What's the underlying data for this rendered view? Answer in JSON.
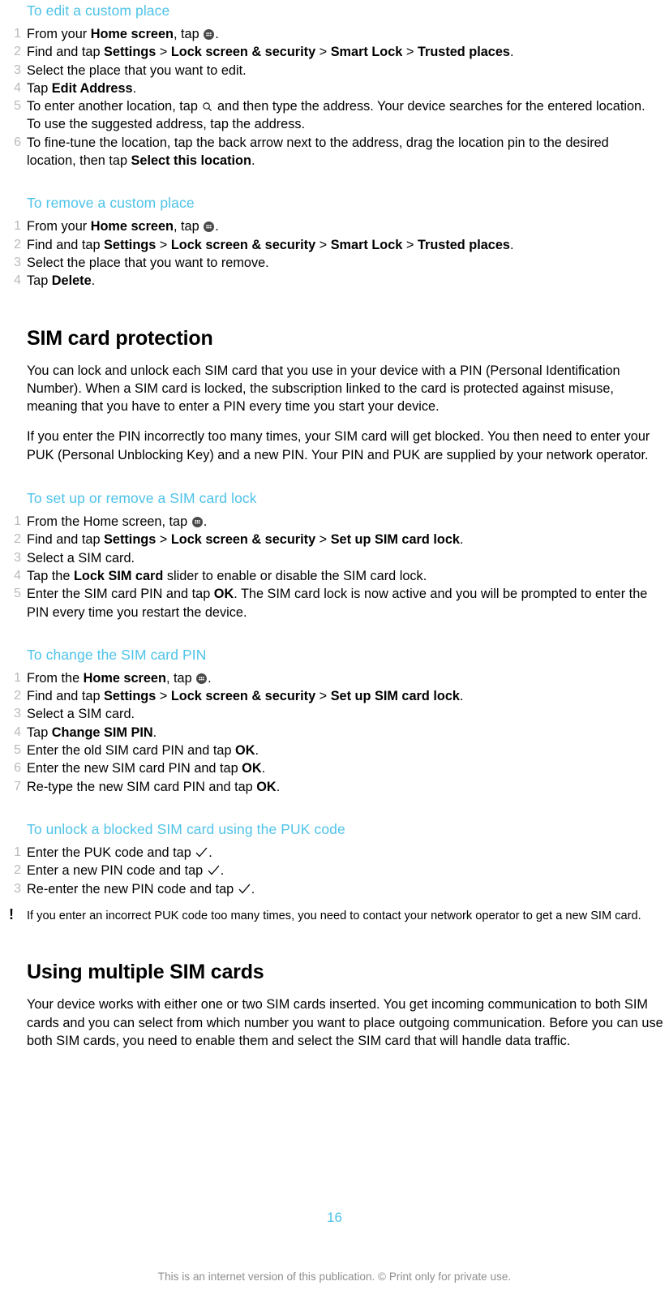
{
  "page": {
    "number": "16",
    "footer_note": "This is an internet version of this publication. © Print only for private use.",
    "accent_color": "#4ec3e8",
    "number_color": "#b9b9b9",
    "footer_color": "#8f8f8f"
  },
  "icons": {
    "app_drawer": "app-drawer-icon",
    "search": "search-icon",
    "check": "check-icon",
    "note": "!"
  },
  "sections": {
    "edit_custom_place": {
      "heading": "To edit a custom place",
      "steps": [
        {
          "num": "1",
          "parts": [
            {
              "t": "From your "
            },
            {
              "t": "Home screen",
              "b": true
            },
            {
              "t": ", tap "
            },
            {
              "icon": "app-drawer"
            },
            {
              "t": "."
            }
          ]
        },
        {
          "num": "2",
          "parts": [
            {
              "t": "Find and tap "
            },
            {
              "t": "Settings",
              "b": true
            },
            {
              "t": " > "
            },
            {
              "t": "Lock screen & security",
              "b": true
            },
            {
              "t": " > "
            },
            {
              "t": "Smart Lock",
              "b": true
            },
            {
              "t": " > "
            },
            {
              "t": "Trusted places",
              "b": true
            },
            {
              "t": "."
            }
          ]
        },
        {
          "num": "3",
          "parts": [
            {
              "t": "Select the place that you want to edit."
            }
          ]
        },
        {
          "num": "4",
          "parts": [
            {
              "t": "Tap "
            },
            {
              "t": "Edit Address",
              "b": true
            },
            {
              "t": "."
            }
          ]
        },
        {
          "num": "5",
          "parts": [
            {
              "t": "To enter another location, tap "
            },
            {
              "icon": "search"
            },
            {
              "t": " and then type the address. Your device searches for the entered location. To use the suggested address, tap the address."
            }
          ]
        },
        {
          "num": "6",
          "parts": [
            {
              "t": "To fine-tune the location, tap the back arrow next to the address, drag the location pin to the desired location, then tap "
            },
            {
              "t": "Select this location",
              "b": true
            },
            {
              "t": "."
            }
          ]
        }
      ]
    },
    "remove_custom_place": {
      "heading": "To remove a custom place",
      "steps": [
        {
          "num": "1",
          "parts": [
            {
              "t": "From your "
            },
            {
              "t": "Home screen",
              "b": true
            },
            {
              "t": ", tap "
            },
            {
              "icon": "app-drawer"
            },
            {
              "t": "."
            }
          ]
        },
        {
          "num": "2",
          "parts": [
            {
              "t": "Find and tap "
            },
            {
              "t": "Settings",
              "b": true
            },
            {
              "t": " > "
            },
            {
              "t": "Lock screen & security",
              "b": true
            },
            {
              "t": " > "
            },
            {
              "t": "Smart Lock",
              "b": true
            },
            {
              "t": " > "
            },
            {
              "t": "Trusted places",
              "b": true
            },
            {
              "t": "."
            }
          ]
        },
        {
          "num": "3",
          "parts": [
            {
              "t": "Select the place that you want to remove."
            }
          ]
        },
        {
          "num": "4",
          "parts": [
            {
              "t": "Tap "
            },
            {
              "t": "Delete",
              "b": true
            },
            {
              "t": "."
            }
          ]
        }
      ]
    },
    "sim_card_protection": {
      "title": "SIM card protection",
      "paragraphs": [
        "You can lock and unlock each SIM card that you use in your device with a PIN (Personal Identification Number). When a SIM card is locked, the subscription linked to the card is protected against misuse, meaning that you have to enter a PIN every time you start your device.",
        "If you enter the PIN incorrectly too many times, your SIM card will get blocked. You then need to enter your PUK (Personal Unblocking Key) and a new PIN. Your PIN and PUK are supplied by your network operator."
      ]
    },
    "setup_sim_lock": {
      "heading": "To set up or remove a SIM card lock",
      "steps": [
        {
          "num": "1",
          "parts": [
            {
              "t": "From the Home screen, tap "
            },
            {
              "icon": "app-drawer"
            },
            {
              "t": "."
            }
          ]
        },
        {
          "num": "2",
          "parts": [
            {
              "t": "Find and tap "
            },
            {
              "t": "Settings",
              "b": true
            },
            {
              "t": " > "
            },
            {
              "t": "Lock screen & security",
              "b": true
            },
            {
              "t": " > "
            },
            {
              "t": "Set up SIM card lock",
              "b": true
            },
            {
              "t": "."
            }
          ]
        },
        {
          "num": "3",
          "parts": [
            {
              "t": "Select a SIM card."
            }
          ]
        },
        {
          "num": "4",
          "parts": [
            {
              "t": "Tap the "
            },
            {
              "t": "Lock SIM card",
              "b": true
            },
            {
              "t": " slider to enable or disable the SIM card lock."
            }
          ]
        },
        {
          "num": "5",
          "parts": [
            {
              "t": "Enter the SIM card PIN and tap "
            },
            {
              "t": "OK",
              "b": true
            },
            {
              "t": ". The SIM card lock is now active and you will be prompted to enter the PIN every time you restart the device."
            }
          ]
        }
      ]
    },
    "change_sim_pin": {
      "heading": "To change the SIM card PIN",
      "steps": [
        {
          "num": "1",
          "parts": [
            {
              "t": "From the "
            },
            {
              "t": "Home screen",
              "b": true
            },
            {
              "t": ", tap "
            },
            {
              "icon": "app-drawer"
            },
            {
              "t": "."
            }
          ]
        },
        {
          "num": "2",
          "parts": [
            {
              "t": "Find and tap "
            },
            {
              "t": "Settings",
              "b": true
            },
            {
              "t": " > "
            },
            {
              "t": "Lock screen & security",
              "b": true
            },
            {
              "t": " > "
            },
            {
              "t": "Set up SIM card lock",
              "b": true
            },
            {
              "t": "."
            }
          ]
        },
        {
          "num": "3",
          "parts": [
            {
              "t": "Select a SIM card."
            }
          ]
        },
        {
          "num": "4",
          "parts": [
            {
              "t": "Tap "
            },
            {
              "t": "Change SIM PIN",
              "b": true
            },
            {
              "t": "."
            }
          ]
        },
        {
          "num": "5",
          "parts": [
            {
              "t": "Enter the old SIM card PIN and tap "
            },
            {
              "t": "OK",
              "b": true
            },
            {
              "t": "."
            }
          ]
        },
        {
          "num": "6",
          "parts": [
            {
              "t": "Enter the new SIM card PIN and tap "
            },
            {
              "t": "OK",
              "b": true
            },
            {
              "t": "."
            }
          ]
        },
        {
          "num": "7",
          "parts": [
            {
              "t": "Re-type the new SIM card PIN and tap "
            },
            {
              "t": "OK",
              "b": true
            },
            {
              "t": "."
            }
          ]
        }
      ]
    },
    "unlock_puk": {
      "heading": "To unlock a blocked SIM card using the PUK code",
      "steps": [
        {
          "num": "1",
          "parts": [
            {
              "t": "Enter the PUK code and tap "
            },
            {
              "icon": "check"
            },
            {
              "t": "."
            }
          ]
        },
        {
          "num": "2",
          "parts": [
            {
              "t": "Enter a new PIN code and tap "
            },
            {
              "icon": "check"
            },
            {
              "t": "."
            }
          ]
        },
        {
          "num": "3",
          "parts": [
            {
              "t": "Re-enter the new PIN code and tap "
            },
            {
              "icon": "check"
            },
            {
              "t": "."
            }
          ]
        }
      ],
      "note": "If you enter an incorrect PUK code too many times, you need to contact your network operator to get a new SIM card."
    },
    "multiple_sim": {
      "title": "Using multiple SIM cards",
      "paragraphs": [
        "Your device works with either one or two SIM cards inserted. You get incoming communication to both SIM cards and you can select from which number you want to place outgoing communication. Before you can use both SIM cards, you need to enable them and select the SIM card that will handle data traffic."
      ]
    }
  }
}
